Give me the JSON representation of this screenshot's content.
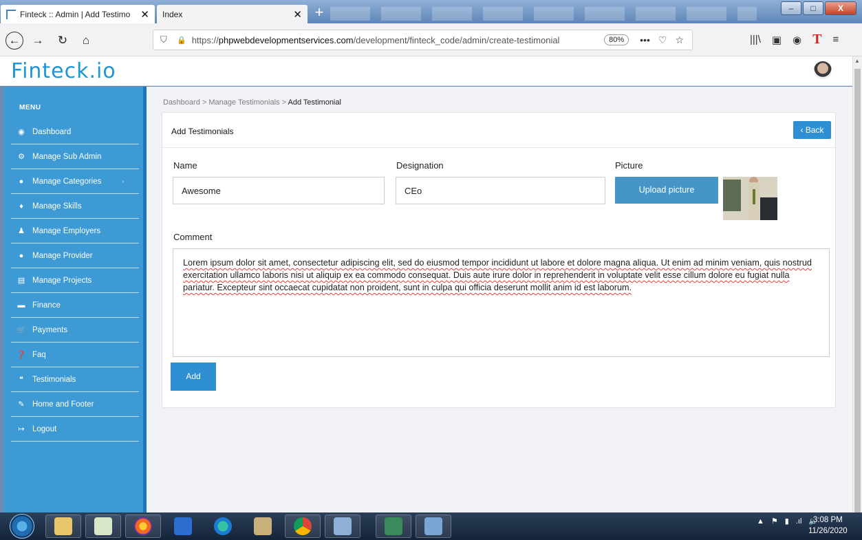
{
  "browser": {
    "tabs": [
      {
        "title": "Finteck :: Admin | Add Testimo"
      },
      {
        "title": "Index"
      }
    ],
    "url_prefix": "https://",
    "url_domain": "phpwebdevelopmentservices.com",
    "url_path": "/development/finteck_code/admin/create-testimonial",
    "zoom": "80%",
    "window_buttons": {
      "minimize": "–",
      "maximize": "□",
      "close": "X"
    }
  },
  "app": {
    "logo": "Finteck.io"
  },
  "sidebar": {
    "heading": "MENU",
    "items": [
      {
        "label": "Dashboard",
        "icon": "dashboard-icon",
        "glyph": "◉"
      },
      {
        "label": "Manage Sub Admin",
        "icon": "cogs-icon",
        "glyph": "⚙"
      },
      {
        "label": "Manage Categories",
        "icon": "user-icon",
        "glyph": "●",
        "caret": "›"
      },
      {
        "label": "Manage Skills",
        "icon": "bulb-icon",
        "glyph": "♦"
      },
      {
        "label": "Manage Employers",
        "icon": "users-icon",
        "glyph": "♟"
      },
      {
        "label": "Manage Provider",
        "icon": "user-icon",
        "glyph": "●"
      },
      {
        "label": "Manage Projects",
        "icon": "list-icon",
        "glyph": "▤"
      },
      {
        "label": "Finance",
        "icon": "card-icon",
        "glyph": "▬"
      },
      {
        "label": "Payments",
        "icon": "cart-icon",
        "glyph": "🛒"
      },
      {
        "label": "Faq",
        "icon": "question-icon",
        "glyph": "❓"
      },
      {
        "label": "Testimonials",
        "icon": "quote-icon",
        "glyph": "❝"
      },
      {
        "label": "Home and Footer",
        "icon": "pencil-icon",
        "glyph": "✎"
      },
      {
        "label": "Logout",
        "icon": "logout-icon",
        "glyph": "↦"
      }
    ]
  },
  "breadcrumb": {
    "items": [
      "Dashboard",
      "Manage Testimonials"
    ],
    "separator": ">",
    "current": "Add Testimonial"
  },
  "form": {
    "title": "Add Testimonials",
    "back_label": "‹ Back",
    "name_label": "Name",
    "name_value": "Awesome",
    "designation_label": "Designation",
    "designation_value": "CEo",
    "picture_label": "Picture",
    "upload_label": "Upload picture",
    "comment_label": "Comment",
    "comment_value": "Lorem ipsum dolor sit amet, consectetur adipiscing elit, sed do eiusmod tempor incididunt ut labore et dolore magna aliqua. Ut enim ad minim veniam, quis nostrud exercitation ullamco laboris nisi ut aliquip ex ea commodo consequat. Duis aute irure dolor in reprehenderit in voluptate velit esse cillum dolore eu fugiat nulla pariatur. Excepteur sint occaecat cupidatat non proident, sunt in culpa qui officia deserunt mollit anim id est laborum.",
    "add_label": "Add"
  },
  "taskbar": {
    "time": "3:08 PM",
    "date": "11/26/2020"
  },
  "colors": {
    "sidebar": "#3d9ad4",
    "accent": "#2f8fd3",
    "logo": "#1e96d6"
  }
}
